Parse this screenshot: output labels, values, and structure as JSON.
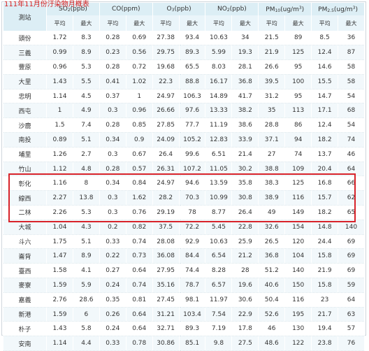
{
  "caption": "111年11月份汙染物月概表",
  "header": {
    "station": "測站",
    "so2": {
      "base": "SO",
      "sub": "2",
      "unit": "(ppb)"
    },
    "co": {
      "label": "CO(ppm)"
    },
    "o3": {
      "base": "O",
      "sub": "3",
      "unit": "(ppb)"
    },
    "no2": {
      "base": "NO",
      "sub": "2",
      "unit": "(ppb)"
    },
    "pm10": {
      "base": "PM",
      "sub": "10",
      "unit_a": "(ug/m",
      "sup": "3",
      "unit_b": ")"
    },
    "pm25": {
      "base": "PM",
      "sub": "2.5",
      "unit_a": "(ug/m",
      "sup": "3",
      "unit_b": ")"
    },
    "avg": "平均",
    "max": "最大"
  },
  "rows": [
    {
      "station": "頭份",
      "v": [
        "1.72",
        "8.3",
        "0.28",
        "0.69",
        "27.38",
        "93.4",
        "10.63",
        "34",
        "21.5",
        "89",
        "8.5",
        "36"
      ]
    },
    {
      "station": "三義",
      "v": [
        "0.99",
        "8.9",
        "0.23",
        "0.56",
        "29.75",
        "89.3",
        "5.99",
        "19.3",
        "21.9",
        "125",
        "12.4",
        "87"
      ]
    },
    {
      "station": "豐原",
      "v": [
        "0.96",
        "5.3",
        "0.28",
        "0.72",
        "19.68",
        "65.5",
        "8.03",
        "28.1",
        "26.6",
        "95",
        "14.6",
        "58"
      ]
    },
    {
      "station": "大里",
      "v": [
        "1.43",
        "5.5",
        "0.41",
        "1.02",
        "22.3",
        "88.8",
        "16.17",
        "36.8",
        "39.5",
        "100",
        "15.5",
        "58"
      ]
    },
    {
      "station": "忠明",
      "v": [
        "1.14",
        "4.5",
        "0.37",
        "1",
        "24.97",
        "106.3",
        "14.89",
        "41.7",
        "31.2",
        "95",
        "14.7",
        "54"
      ]
    },
    {
      "station": "西屯",
      "v": [
        "1",
        "4.9",
        "0.3",
        "0.96",
        "26.66",
        "97.6",
        "13.33",
        "38.2",
        "35",
        "113",
        "17.1",
        "68"
      ]
    },
    {
      "station": "沙鹿",
      "v": [
        "1.5",
        "7.4",
        "0.28",
        "0.85",
        "27.85",
        "77.7",
        "11.19",
        "38.6",
        "28.8",
        "86",
        "12.4",
        "54"
      ]
    },
    {
      "station": "南投",
      "v": [
        "0.89",
        "5.1",
        "0.34",
        "0.9",
        "24.09",
        "105.2",
        "12.83",
        "33.9",
        "37.1",
        "94",
        "18.2",
        "74"
      ]
    },
    {
      "station": "埔里",
      "v": [
        "1.26",
        "2.7",
        "0.3",
        "0.67",
        "26.4",
        "99.6",
        "6.51",
        "21.4",
        "27",
        "74",
        "13.7",
        "46"
      ]
    },
    {
      "station": "竹山",
      "v": [
        "1.12",
        "4.8",
        "0.28",
        "0.57",
        "26.31",
        "107.2",
        "11.05",
        "30.2",
        "38.8",
        "109",
        "20.4",
        "64"
      ]
    },
    {
      "station": "彰化",
      "v": [
        "1.16",
        "8",
        "0.34",
        "0.84",
        "24.97",
        "94.6",
        "13.59",
        "35.8",
        "38.3",
        "125",
        "16.8",
        "66"
      ]
    },
    {
      "station": "線西",
      "v": [
        "2.27",
        "13.8",
        "0.3",
        "1.62",
        "28.2",
        "70.3",
        "10.99",
        "30.8",
        "38.9",
        "116",
        "15.7",
        "62"
      ]
    },
    {
      "station": "二林",
      "v": [
        "2.26",
        "5.3",
        "0.3",
        "0.76",
        "29.19",
        "78",
        "8.77",
        "26.4",
        "49",
        "149",
        "18.2",
        "65"
      ]
    },
    {
      "station": "大城",
      "v": [
        "1.04",
        "4.3",
        "0.2",
        "0.82",
        "37.5",
        "72.2",
        "5.45",
        "22.8",
        "32.6",
        "154",
        "14.8",
        "140"
      ]
    },
    {
      "station": "斗六",
      "v": [
        "1.75",
        "5.1",
        "0.33",
        "0.74",
        "28.08",
        "92.9",
        "10.63",
        "25.9",
        "26.5",
        "120",
        "24.4",
        "69"
      ]
    },
    {
      "station": "崙背",
      "v": [
        "1.47",
        "8.9",
        "0.22",
        "0.73",
        "36.08",
        "84.4",
        "6.54",
        "21.2",
        "36.8",
        "104",
        "15.8",
        "69"
      ]
    },
    {
      "station": "臺西",
      "v": [
        "1.58",
        "4.1",
        "0.27",
        "0.64",
        "27.95",
        "74.4",
        "8.28",
        "28",
        "51.2",
        "140",
        "21.9",
        "69"
      ]
    },
    {
      "station": "麥寮",
      "v": [
        "1.59",
        "5.9",
        "0.24",
        "0.74",
        "35.16",
        "78.7",
        "6.57",
        "19.6",
        "40.6",
        "150",
        "15.8",
        "59"
      ]
    },
    {
      "station": "嘉義",
      "v": [
        "2.76",
        "28.6",
        "0.35",
        "0.81",
        "27.45",
        "98.1",
        "11.97",
        "30.6",
        "50.4",
        "116",
        "23",
        "64"
      ]
    },
    {
      "station": "新港",
      "v": [
        "1.59",
        "6",
        "0.26",
        "0.64",
        "31.21",
        "103.4",
        "7.54",
        "22.9",
        "52.6",
        "195",
        "21.7",
        "63"
      ]
    },
    {
      "station": "朴子",
      "v": [
        "1.43",
        "5.8",
        "0.24",
        "0.64",
        "32.71",
        "89.3",
        "7.19",
        "17.8",
        "46",
        "130",
        "19.4",
        "57"
      ]
    },
    {
      "station": "安南",
      "v": [
        "1.14",
        "4.4",
        "0.33",
        "0.78",
        "30.86",
        "85.1",
        "9.8",
        "27.5",
        "48.6",
        "122",
        "23.8",
        "76"
      ]
    }
  ]
}
